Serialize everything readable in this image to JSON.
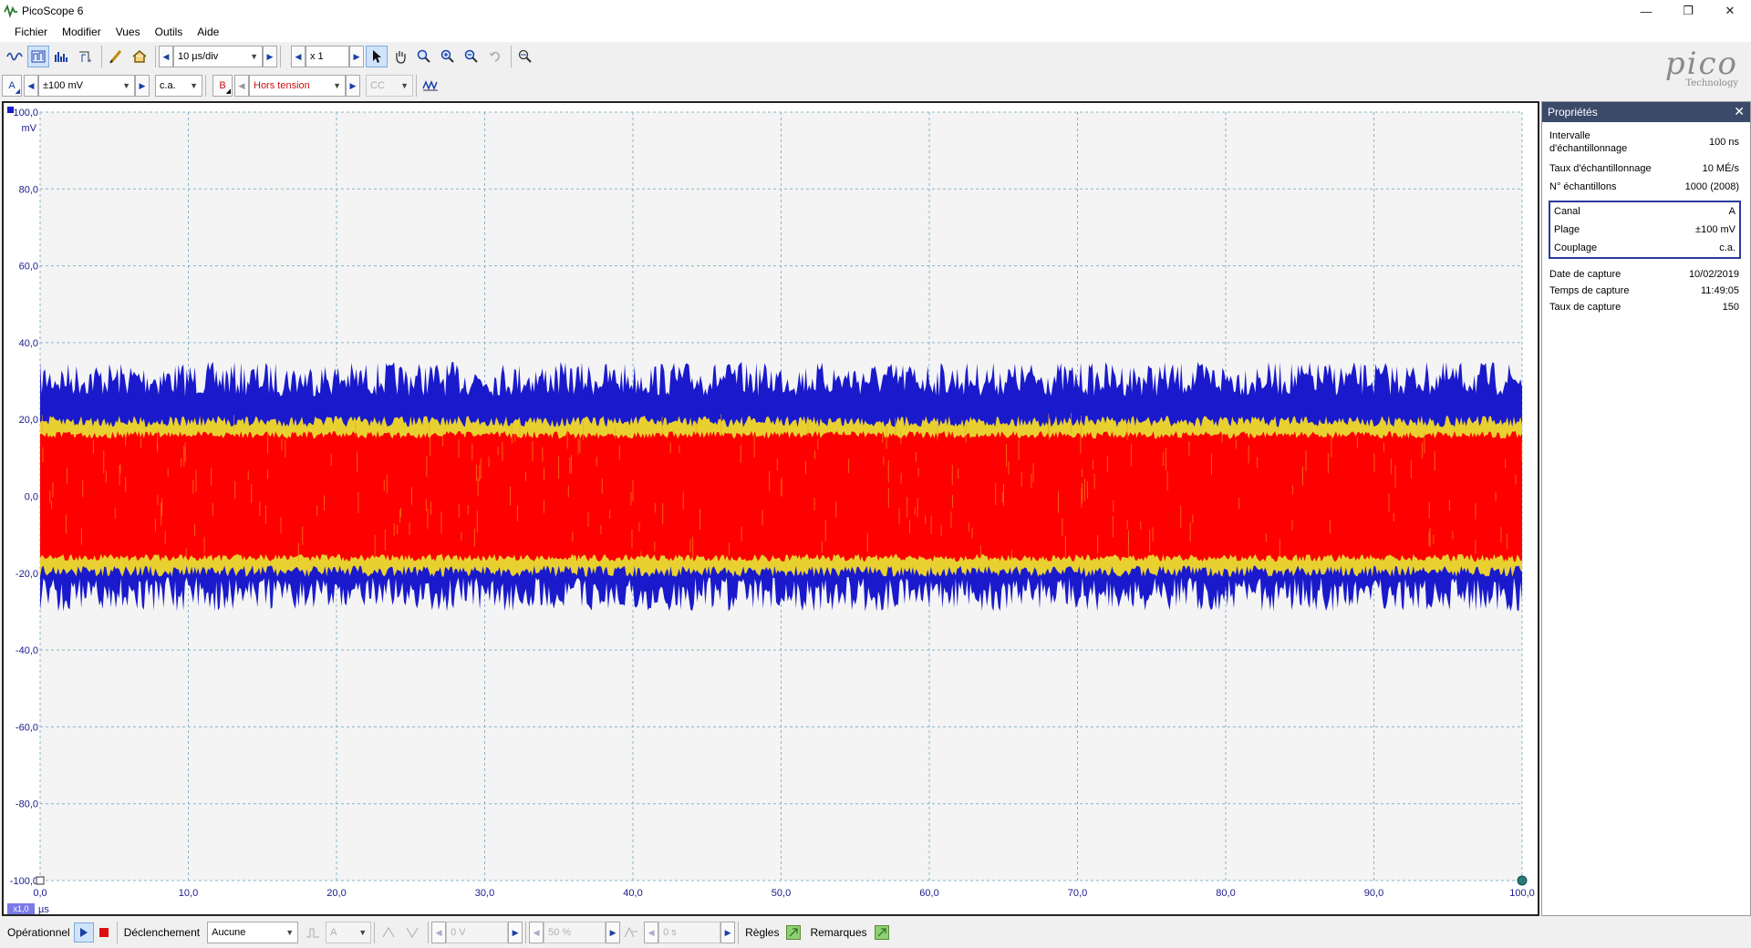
{
  "window": {
    "title": "PicoScope 6",
    "minimize": "—",
    "restore": "❐",
    "close": "✕"
  },
  "menu": [
    "Fichier",
    "Modifier",
    "Vues",
    "Outils",
    "Aide"
  ],
  "toolbar1": {
    "timebase": "10 µs/div",
    "zoom": "x 1"
  },
  "toolbar2": {
    "channel_a": "A",
    "range_a": "±100 mV",
    "coupling_a": "c.a.",
    "channel_b": "B",
    "range_b": "Hors tension",
    "coupling_b": "CC"
  },
  "logo": {
    "text": "pico",
    "subtext": "Technology"
  },
  "scope": {
    "y_unit": "mV",
    "x_unit": "µs",
    "x_zoom_badge": "x1,0",
    "y_ticks": [
      "100,0",
      "80,0",
      "60,0",
      "40,0",
      "20,0",
      "0,0",
      "-20,0",
      "-40,0",
      "-60,0",
      "-80,0",
      "-100,0"
    ],
    "x_ticks": [
      "0,0",
      "10,0",
      "20,0",
      "30,0",
      "40,0",
      "50,0",
      "60,0",
      "70,0",
      "80,0",
      "90,0",
      "100,0"
    ],
    "colors": {
      "trace_outer": "#1a1acc",
      "trace_mid": "#ffee00",
      "trace_core": "#ff0000",
      "grid": "#8ab4c8",
      "axis_text": "#1a1a8a"
    }
  },
  "chart_data": {
    "type": "line",
    "title": "",
    "xlabel": "µs",
    "ylabel": "mV",
    "xlim": [
      0,
      100
    ],
    "ylim": [
      -100,
      100
    ],
    "grid": true,
    "series": [
      {
        "name": "A",
        "description_band": {
          "envelope_max": 35,
          "envelope_min": -30,
          "dense_core_max": 17,
          "dense_core_min": -17
        }
      }
    ]
  },
  "properties": {
    "title": "Propriétés",
    "rows_top": [
      {
        "label": "Intervalle d'échantillonnage",
        "value": "100 ns"
      },
      {
        "label": "Taux d'échantillonnage",
        "value": "10 MÉ/s"
      },
      {
        "label": "N° échantillons",
        "value": "1000  (2008)"
      }
    ],
    "channel_rows": [
      {
        "label": "Canal",
        "value": "A"
      },
      {
        "label": "Plage",
        "value": "±100 mV"
      },
      {
        "label": "Couplage",
        "value": "c.a."
      }
    ],
    "rows_bottom": [
      {
        "label": "Date de capture",
        "value": "10/02/2019"
      },
      {
        "label": "Temps de capture",
        "value": "11:49:05"
      },
      {
        "label": "Taux de capture",
        "value": "150"
      }
    ]
  },
  "status": {
    "mode": "Opérationnel",
    "trigger_label": "Déclenchement",
    "trigger_mode": "Aucune",
    "trigger_source": "A",
    "threshold": "0 V",
    "pre_trigger": "50 %",
    "delay": "0 s",
    "rulers": "Règles",
    "notes": "Remarques"
  }
}
